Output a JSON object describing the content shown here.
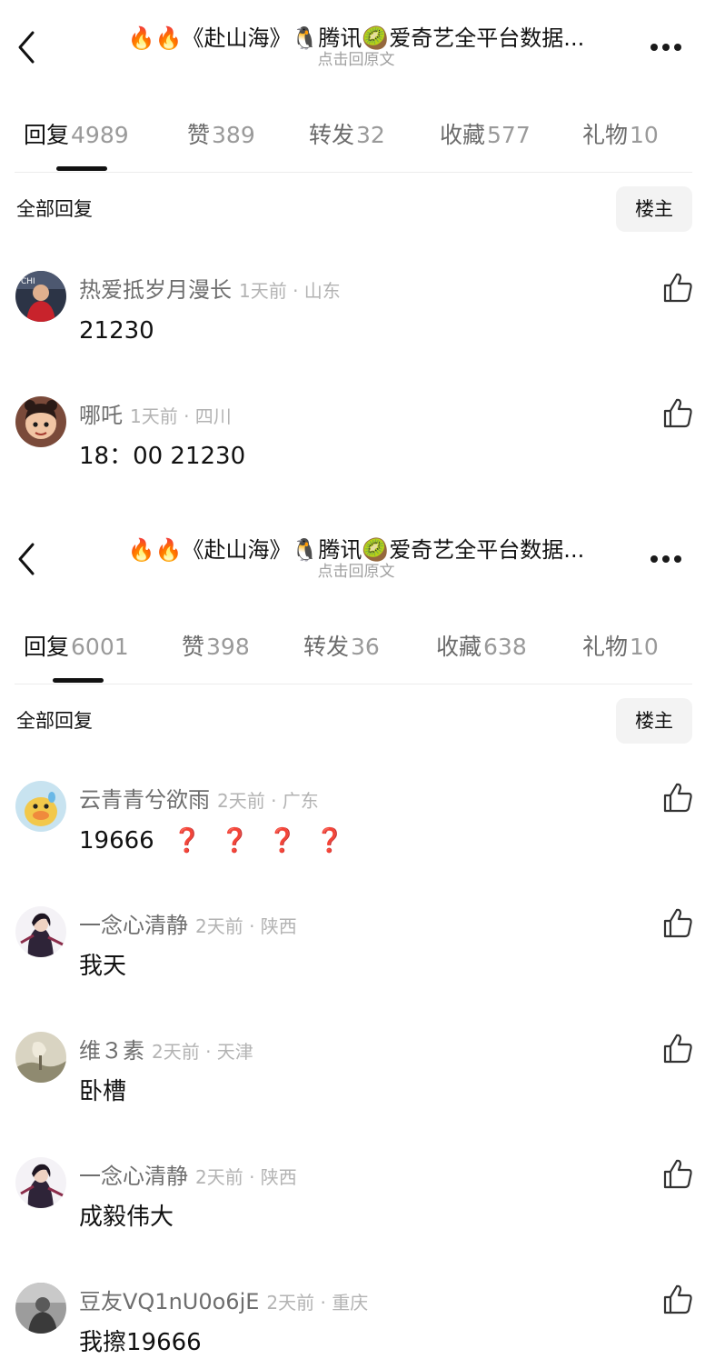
{
  "panels": [
    {
      "header": {
        "title": "🔥🔥《赴山海》🐧腾讯🥝爱奇艺全平台数据...",
        "subtitle": "点击回原文"
      },
      "tabs": [
        {
          "label": "回复",
          "count": "4989"
        },
        {
          "label": "赞",
          "count": "389"
        },
        {
          "label": "转发",
          "count": "32"
        },
        {
          "label": "收藏",
          "count": "577"
        },
        {
          "label": "礼物",
          "count": "10"
        }
      ],
      "filter": {
        "label": "全部回复",
        "button": "楼主"
      },
      "comments": [
        {
          "user": "热爱抵岁月漫长",
          "info": "1天前 · 山东",
          "text": "21230",
          "avatar": "avatar-photo"
        },
        {
          "user": "哪吒",
          "info": "1天前 · 四川",
          "text": "18：00  21230",
          "avatar": "avatar-cartoon"
        }
      ]
    },
    {
      "header": {
        "title": "🔥🔥《赴山海》🐧腾讯🥝爱奇艺全平台数据...",
        "subtitle": "点击回原文"
      },
      "tabs": [
        {
          "label": "回复",
          "count": "6001"
        },
        {
          "label": "赞",
          "count": "398"
        },
        {
          "label": "转发",
          "count": "36"
        },
        {
          "label": "收藏",
          "count": "638"
        },
        {
          "label": "礼物",
          "count": "10"
        }
      ],
      "filter": {
        "label": "全部回复",
        "button": "楼主"
      },
      "comments": [
        {
          "user": "云青青兮欲雨",
          "info": "2天前 · 广东",
          "text": "19666",
          "marks": [
            "❓",
            "❓",
            "❓",
            "❓"
          ],
          "avatar": "avatar-duck"
        },
        {
          "user": "一念心清静",
          "info": "2天前 · 陕西",
          "text": "我天",
          "avatar": "avatar-figure"
        },
        {
          "user": "维３素",
          "info": "2天前 · 天津",
          "text": "卧槽",
          "avatar": "avatar-scenery"
        },
        {
          "user": "一念心清静",
          "info": "2天前 · 陕西",
          "text": "成毅伟大",
          "avatar": "avatar-figure"
        },
        {
          "user": "豆友VQ1nU0o6jE",
          "info": "2天前 · 重庆",
          "text": "我擦19666",
          "avatar": "avatar-gray"
        }
      ]
    }
  ],
  "colors": {
    "accent": "#111111",
    "secondary_text": "#6e6e6e",
    "meta_text": "#b3b3b3",
    "question_mark": "#c9302c",
    "button_bg": "#f3f3f3"
  }
}
